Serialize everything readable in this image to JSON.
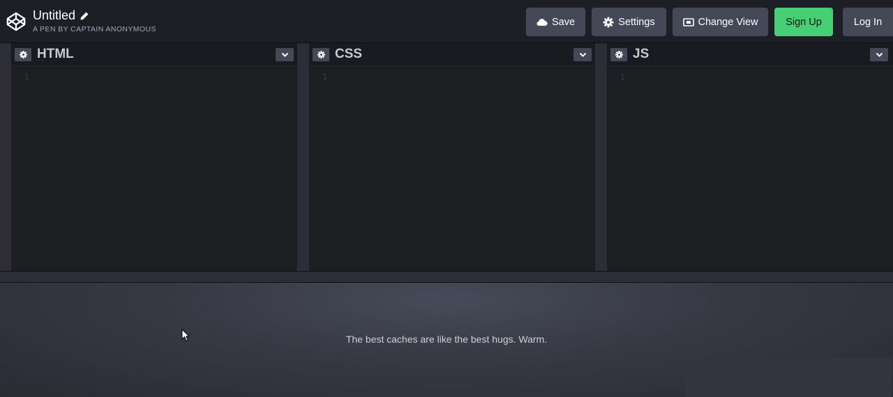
{
  "header": {
    "pen_title": "Untitled",
    "pen_subtitle": "A PEN BY CAPTAIN ANONYMOUS",
    "buttons": {
      "save": "Save",
      "settings": "Settings",
      "change_view": "Change View",
      "sign_up": "Sign Up",
      "log_in": "Log In"
    }
  },
  "editors": [
    {
      "name": "HTML",
      "line": "1"
    },
    {
      "name": "CSS",
      "line": "1"
    },
    {
      "name": "JS",
      "line": "1"
    }
  ],
  "preview": {
    "message": "The best caches are like the best hugs. Warm."
  },
  "colors": {
    "signup_green": "#47cf73",
    "button_gray": "#444857",
    "background": "#1e1f26"
  }
}
